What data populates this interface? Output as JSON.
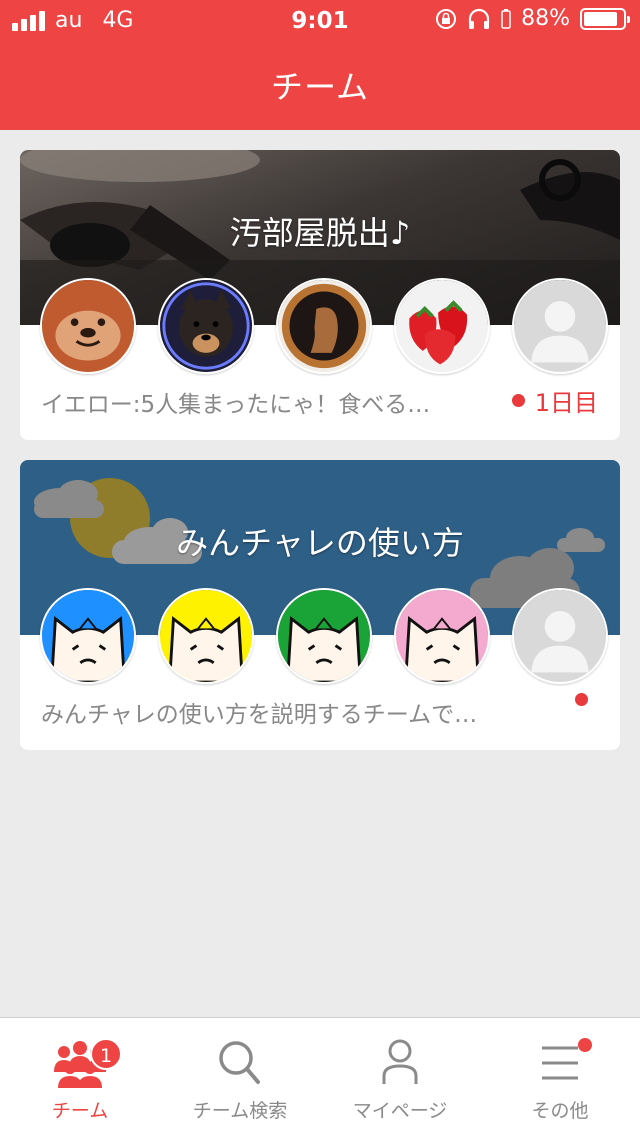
{
  "status_bar": {
    "carrier": "au",
    "network": "4G",
    "time": "9:01",
    "battery": "88%",
    "battery_level": 0.88
  },
  "header": {
    "title": "チーム"
  },
  "teams": [
    {
      "name": "汚部屋脱出♪",
      "snippet": "イエロー:5人集まったにゃ！食べる…",
      "status": "1日目",
      "members": [
        "otter-avatar",
        "shiba-dog-avatar",
        "penny-coin-avatar",
        "strawberry-avatar",
        "placeholder-avatar"
      ]
    },
    {
      "name": "みんチャレの使い方",
      "snippet": "みんチャレの使い方を説明するチームで…",
      "status": "",
      "members": [
        "cat-blue-avatar",
        "cat-yellow-avatar",
        "cat-green-avatar",
        "cat-pink-avatar",
        "placeholder-avatar"
      ]
    }
  ],
  "tabbar": {
    "tabs": [
      {
        "label": "チーム",
        "icon": "team-icon",
        "badge": "1",
        "active": true
      },
      {
        "label": "チーム検索",
        "icon": "search-icon",
        "active": false
      },
      {
        "label": "マイページ",
        "icon": "person-icon",
        "active": false
      },
      {
        "label": "その他",
        "icon": "menu-icon",
        "active": false
      }
    ]
  },
  "colors": {
    "brand": "#ef4444",
    "background": "#ebebeb",
    "banner_blue": "#2e5f86"
  }
}
